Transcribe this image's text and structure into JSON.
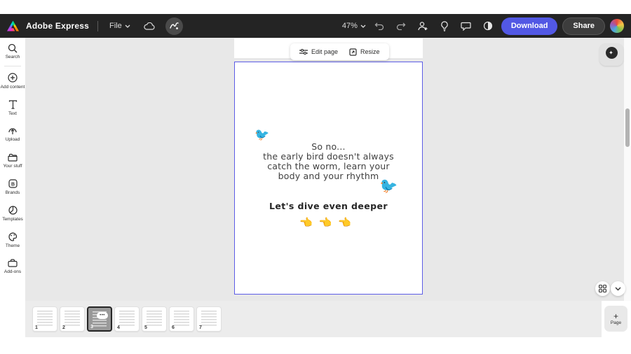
{
  "topbar": {
    "brand": "Adobe Express",
    "file_menu_label": "File",
    "zoom_level": "47%",
    "download_label": "Download",
    "share_label": "Share",
    "colors": {
      "bar_bg": "#242424",
      "download_bg": "#5258E4",
      "share_bg": "#3D3D3D"
    }
  },
  "sidebar": {
    "items": [
      {
        "label": "Search",
        "icon": "search-icon"
      },
      {
        "label": "Add content",
        "icon": "add-content-icon"
      },
      {
        "label": "Text",
        "icon": "text-icon"
      },
      {
        "label": "Upload",
        "icon": "upload-icon"
      },
      {
        "label": "Your stuff",
        "icon": "your-stuff-icon"
      },
      {
        "label": "Brands",
        "icon": "brands-icon"
      },
      {
        "label": "Templates",
        "icon": "templates-icon"
      },
      {
        "label": "Theme",
        "icon": "theme-icon"
      },
      {
        "label": "Add-ons",
        "icon": "add-ons-icon"
      }
    ]
  },
  "canvas_toolbar": {
    "edit_page_label": "Edit page",
    "resize_label": "Resize"
  },
  "page": {
    "main_text_lines": {
      "0": "So no...",
      "1": "the early bird doesn't always",
      "2": "catch the worm, learn your",
      "3": "body and your rhythm"
    },
    "subtitle": "Let's dive even deeper",
    "bird_emoji": "🐦",
    "pointer_emoji": "👈",
    "pointer_count": 3,
    "border_color": "#5C5CE6"
  },
  "pages_panel": {
    "thumbnails": [
      {
        "number": "1"
      },
      {
        "number": "2"
      },
      {
        "number": "3"
      },
      {
        "number": "4"
      },
      {
        "number": "5"
      },
      {
        "number": "6"
      },
      {
        "number": "7"
      }
    ],
    "selected_page": "3",
    "ellipsis": "•••",
    "add_page_plus": "+",
    "add_page_label": "Page"
  },
  "floating": {
    "assistant_glyph": "✦"
  }
}
